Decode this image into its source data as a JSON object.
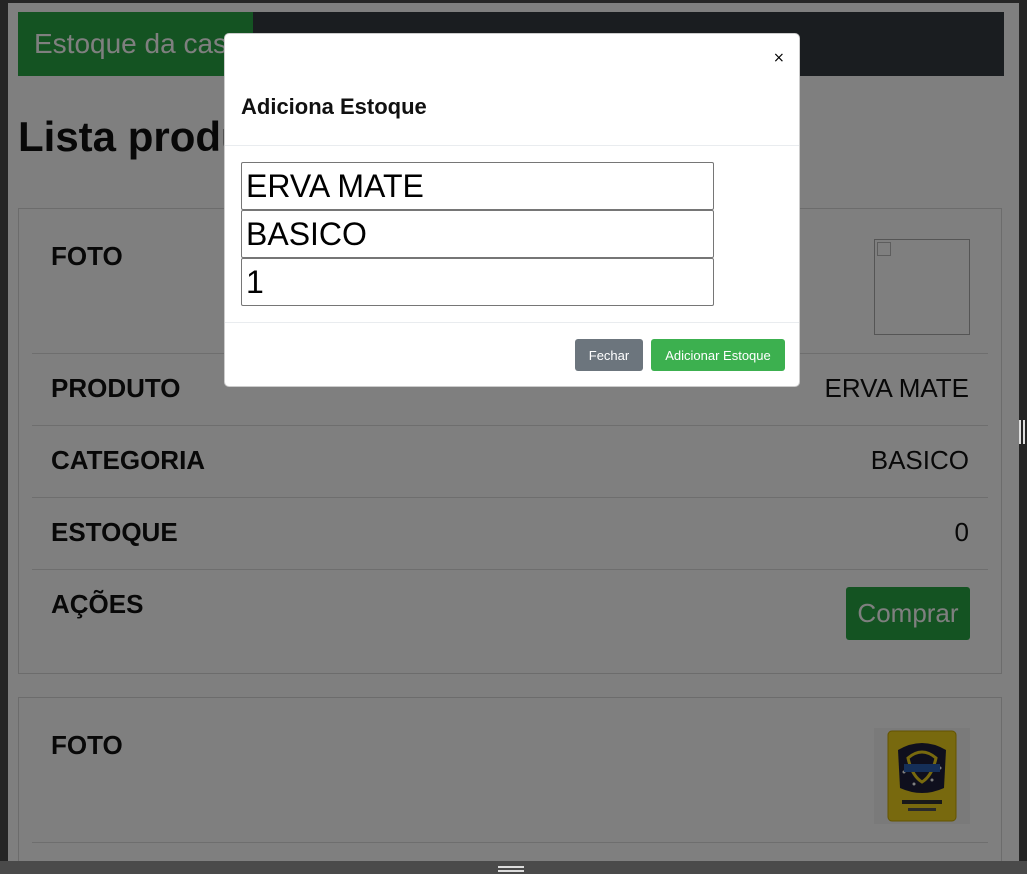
{
  "navbar": {
    "brand": "Estoque da casa"
  },
  "page": {
    "title": "Lista produtos"
  },
  "product_cards": [
    {
      "foto_label": "FOTO",
      "produto_label": "PRODUTO",
      "produto_value": "ERVA MATE",
      "categoria_label": "CATEGORIA",
      "categoria_value": "BASICO",
      "estoque_label": "ESTOQUE",
      "estoque_value": "0",
      "acoes_label": "AÇÕES",
      "buy_label": "Comprar"
    },
    {
      "foto_label": "FOTO"
    }
  ],
  "modal": {
    "title": "Adiciona Estoque",
    "close_glyph": "×",
    "inputs": {
      "product": "ERVA MATE",
      "category": "BASICO",
      "quantity": "1"
    },
    "buttons": {
      "close": "Fechar",
      "add_stock": "Adicionar Estoque"
    }
  },
  "colors": {
    "brand_green": "#28a745",
    "navbar_dark": "#343a40",
    "secondary": "#6c757d",
    "success": "#3cb04f"
  },
  "icons": {
    "modal_close": "close-icon",
    "broken_image": "broken-image-icon"
  }
}
